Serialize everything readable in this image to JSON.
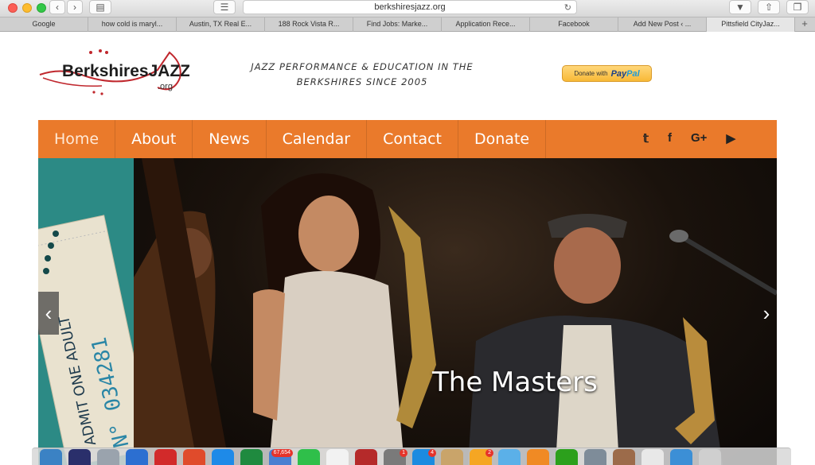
{
  "browser": {
    "url": "berkshiresjazz.org",
    "tabs": [
      {
        "label": "Google",
        "active": false
      },
      {
        "label": "how cold is maryl...",
        "active": false
      },
      {
        "label": "Austin, TX Real E...",
        "active": false
      },
      {
        "label": "188 Rock Vista R...",
        "active": false
      },
      {
        "label": "Find Jobs: Marke...",
        "active": false
      },
      {
        "label": "Application Rece...",
        "active": false
      },
      {
        "label": "Facebook",
        "active": false
      },
      {
        "label": "Add New Post ‹ ...",
        "active": false
      },
      {
        "label": "Pittsfield CityJaz...",
        "active": true
      }
    ],
    "add_tab": "+"
  },
  "header": {
    "logo_text": "BerkshiresJAZZ",
    "logo_sub": ".org",
    "tagline_line1": "JAZZ PERFORMANCE & EDUCATION IN THE",
    "tagline_line2": "BERKSHIRES SINCE 2005",
    "paypal_prefix": "Donate with",
    "paypal_brand_pay": "Pay",
    "paypal_brand_pal": "Pal"
  },
  "nav": {
    "items": [
      "Home",
      "About",
      "News",
      "Calendar",
      "Contact",
      "Donate"
    ],
    "accent_color": "#ea7a2b",
    "social_icons": [
      "twitter-icon",
      "facebook-icon",
      "google-plus-icon",
      "youtube-icon"
    ]
  },
  "slider": {
    "caption": "The Masters",
    "ticket_text": "ADMIT ONE ADULT",
    "ticket_number": "N° 034281"
  },
  "dock": {
    "badges": [
      "67,654",
      "1",
      "4",
      "2"
    ]
  }
}
